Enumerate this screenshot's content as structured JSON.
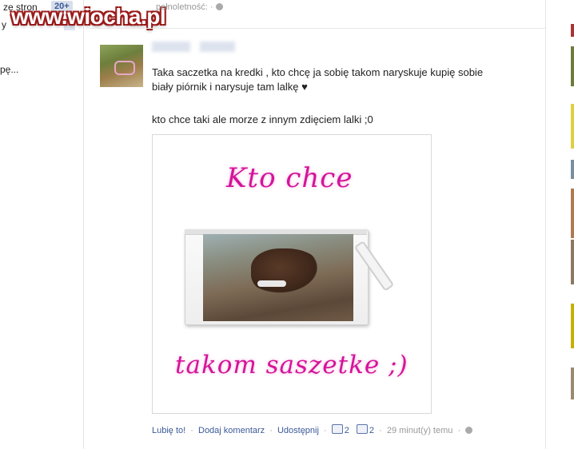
{
  "left": {
    "top_text": "ze stron",
    "badge": "20+",
    "y_text": "y",
    "pe_text": "pę..."
  },
  "watermark": "www.wiocha.pl",
  "top_meta": "pełnoletność: ·",
  "post": {
    "line1": "Taka saczetka na kredki , kto chcę ja sobię takom naryskuje kupię sobie",
    "line2": "biały piórnik i narysuje tam lalkę ♥",
    "line3": "kto chce taki ale morze z innym zdięciem lalki ;0",
    "image_text_top": "Kto chce",
    "image_text_bottom": "takom saszetke ;)"
  },
  "actions": {
    "like": "Lubię to!",
    "comment": "Dodaj komentarz",
    "share": "Udostępnij",
    "likes_count": "2",
    "comments_count": "2",
    "time": "29 minut(y) temu"
  },
  "colors": {
    "link": "#3b5998",
    "image_text": "#d4149a"
  }
}
